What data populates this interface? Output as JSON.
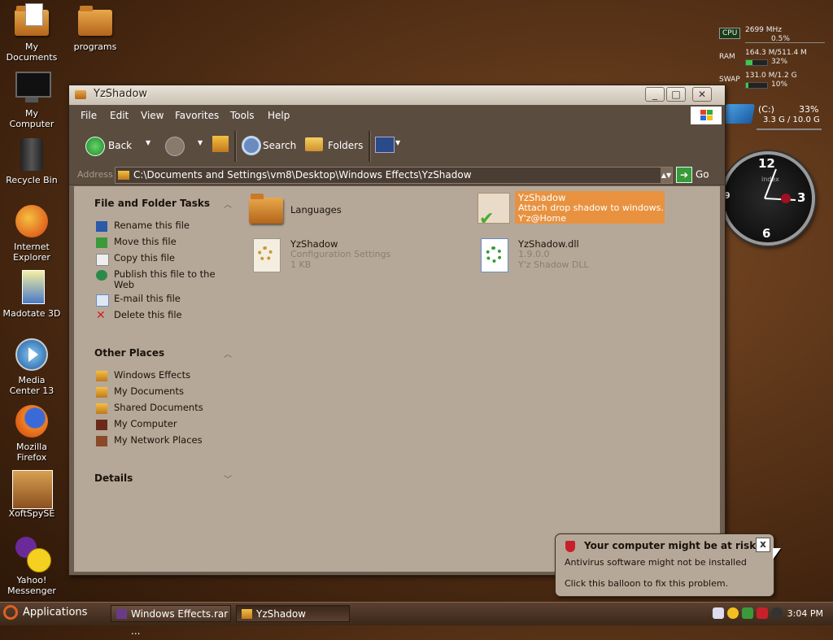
{
  "desktop": {
    "icons": [
      {
        "label": "My\nDocuments"
      },
      {
        "label": "programs"
      },
      {
        "label": "My\nComputer"
      },
      {
        "label": "Recycle Bin"
      },
      {
        "label": "Internet\nExplorer"
      },
      {
        "label": "Madotate 3D"
      },
      {
        "label": "Media\nCenter 13"
      },
      {
        "label": "Mozilla\nFirefox"
      },
      {
        "label": "XoftSpySE"
      },
      {
        "label": "Yahoo!\nMessenger"
      }
    ]
  },
  "sysmon": {
    "cpu": {
      "label": "CPU",
      "freq": "2699 MHz",
      "pct": "0.5%",
      "level": 0.005
    },
    "ram": {
      "label": "RAM",
      "usage": "164.3 M/511.4 M",
      "pct": "32%",
      "level": 0.32
    },
    "swap": {
      "label": "SWAP",
      "usage": "131.0 M/1.2 G",
      "pct": "10%",
      "level": 0.1
    },
    "disk": {
      "label": "(C:)",
      "pct": "33%",
      "usage": "3.3 G / 10.0 G"
    }
  },
  "clock_widget": {
    "n12": "12",
    "n3": "3",
    "n6": "6",
    "n9": "9",
    "brand": "index"
  },
  "window": {
    "title": "YzShadow",
    "menu": [
      "File",
      "Edit",
      "View",
      "Favorites",
      "Tools",
      "Help"
    ],
    "toolbar": {
      "back": "Back",
      "search": "Search",
      "folders": "Folders"
    },
    "address": {
      "label": "Address",
      "path": "C:\\Documents and Settings\\vm8\\Desktop\\Windows Effects\\YzShadow",
      "go": "Go"
    },
    "tasks": {
      "title": "File and Folder Tasks",
      "items": [
        "Rename this file",
        "Move this file",
        "Copy this file",
        "Publish this file to the Web",
        "E-mail this file",
        "Delete this file"
      ]
    },
    "other": {
      "title": "Other Places",
      "items": [
        "Windows Effects",
        "My Documents",
        "Shared Documents",
        "My Computer",
        "My Network Places"
      ]
    },
    "details": {
      "title": "Details"
    },
    "files": [
      {
        "name": "Languages"
      },
      {
        "name": "YzShadow",
        "line1": "Attach drop shadow to windows.",
        "line2": "Y'z@Home"
      },
      {
        "name": "YzShadow",
        "line1": "Configuration Settings",
        "line2": "1 KB"
      },
      {
        "name": "YzShadow.dll",
        "line1": "1.9.0.0",
        "line2": "Y'z Shadow DLL"
      }
    ]
  },
  "taskbar": {
    "start": "Applications",
    "items": [
      "Windows Effects.rar ...",
      "YzShadow"
    ],
    "time": "3:04 PM"
  },
  "balloon": {
    "title": "Your computer might be at risk",
    "line1": "Antivirus software might not be installed",
    "line2": "Click this balloon to fix this problem.",
    "close": "x"
  }
}
